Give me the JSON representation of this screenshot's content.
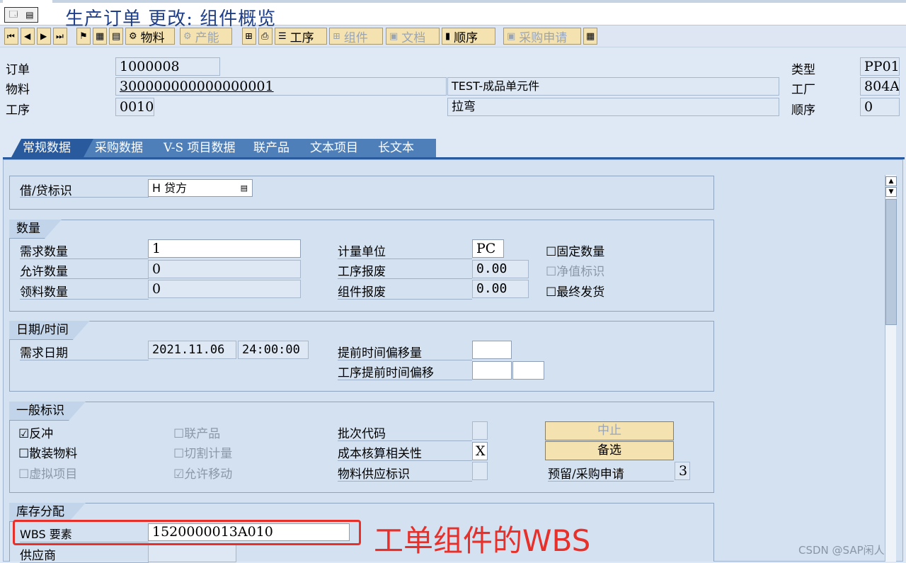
{
  "title": "生产订单 更改: 组件概览",
  "toolbar": {
    "nav": [
      "⏮",
      "◀",
      "▶",
      "⏭"
    ],
    "buttons": [
      {
        "label": "物料",
        "disabled": false
      },
      {
        "label": "产能",
        "disabled": true
      },
      {
        "label": "工序",
        "disabled": false
      },
      {
        "label": "组件",
        "disabled": true
      },
      {
        "label": "文档",
        "disabled": true
      },
      {
        "label": "顺序",
        "disabled": false
      },
      {
        "label": "采购申请",
        "disabled": true
      }
    ]
  },
  "header": {
    "order_label": "订单",
    "order_value": "1000008",
    "material_label": "物料",
    "material_value": "300000000000000001",
    "material_desc": "TEST-成品单元件",
    "operation_label": "工序",
    "operation_value": "0010",
    "operation_desc": "拉弯",
    "type_label": "类型",
    "type_value": "PP01",
    "plant_label": "工厂",
    "plant_value": "804A",
    "sequence_label": "顺序",
    "sequence_value": "0"
  },
  "tabs": [
    "常规数据",
    "采购数据",
    "V-S 项目数据",
    "联产品",
    "文本项目",
    "长文本"
  ],
  "general": {
    "debit_credit_label": "借/贷标识",
    "debit_credit_value": "H 贷方"
  },
  "quantity": {
    "title": "数量",
    "required_qty_label": "需求数量",
    "required_qty": "1",
    "allowed_qty_label": "允许数量",
    "allowed_qty": "0",
    "withdrawn_qty_label": "领料数量",
    "withdrawn_qty": "0",
    "unit_label": "计量单位",
    "unit_value": "PC",
    "op_scrap_label": "工序报废",
    "op_scrap": "0.00",
    "comp_scrap_label": "组件报废",
    "comp_scrap": "0.00",
    "fixed_qty_label": "固定数量",
    "net_id_label": "净值标识",
    "final_issue_label": "最终发货"
  },
  "dates": {
    "title": "日期/时间",
    "req_date_label": "需求日期",
    "req_date": "2021.11.06",
    "req_time": "24:00:00",
    "lead_offset_label": "提前时间偏移量",
    "op_lead_offset_label": "工序提前时间偏移"
  },
  "indicators": {
    "title": "一般标识",
    "backflush_label": "反冲",
    "bulk_label": "散装物料",
    "phantom_label": "虚拟项目",
    "coproduct_label": "联产品",
    "cutting_label": "切割计量",
    "movement_label": "允许移动",
    "batch_code_label": "批次代码",
    "costing_label": "成本核算相关性",
    "costing_value": "X",
    "supply_label": "物料供应标识",
    "abort_button": "中止",
    "alternative_button": "备选",
    "reservation_label": "预留/采购申请",
    "reservation_value": "3"
  },
  "stock": {
    "title": "库存分配",
    "wbs_label": "WBS 要素",
    "wbs_value": "1520000013A010",
    "vendor_label": "供应商"
  },
  "annotation": "工单组件的WBS",
  "watermark": "CSDN @SAP闲人",
  "colors": {
    "tab_active": "#2a5a9e",
    "tab": "#4f7fb8",
    "annotation": "#e8302a",
    "button": "#f4e2b0"
  }
}
